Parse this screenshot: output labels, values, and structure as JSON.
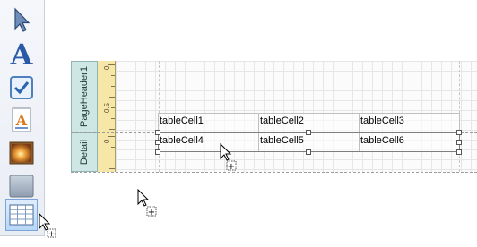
{
  "toolbox": {
    "tools": [
      {
        "name": "pointer",
        "icon": "arrow-pointer-icon",
        "selected": false
      },
      {
        "name": "label",
        "icon": "label-a-icon",
        "selected": false
      },
      {
        "name": "checkbox",
        "icon": "checkbox-icon",
        "selected": false
      },
      {
        "name": "richtext",
        "icon": "rich-text-icon",
        "selected": false
      },
      {
        "name": "picture",
        "icon": "picture-box-icon",
        "selected": false
      },
      {
        "name": "panel",
        "icon": "panel-icon",
        "selected": false
      },
      {
        "name": "table",
        "icon": "table-icon",
        "selected": true
      }
    ]
  },
  "bands": {
    "page_header": {
      "label": "PageHeader1"
    },
    "detail": {
      "label": "Detail"
    }
  },
  "ruler": {
    "page_header_marks": [
      "0",
      "0.5"
    ],
    "detail_marks": [
      "0"
    ]
  },
  "table": {
    "rows": [
      [
        "tableCell1",
        "tableCell2",
        "tableCell3"
      ],
      [
        "tableCell4",
        "tableCell5",
        "tableCell6"
      ]
    ]
  },
  "colors": {
    "band_label_bg": "#cfe7e4",
    "ruler_bg": "#f6e7a8",
    "selected_tool_bg": "#b8d7f7"
  }
}
